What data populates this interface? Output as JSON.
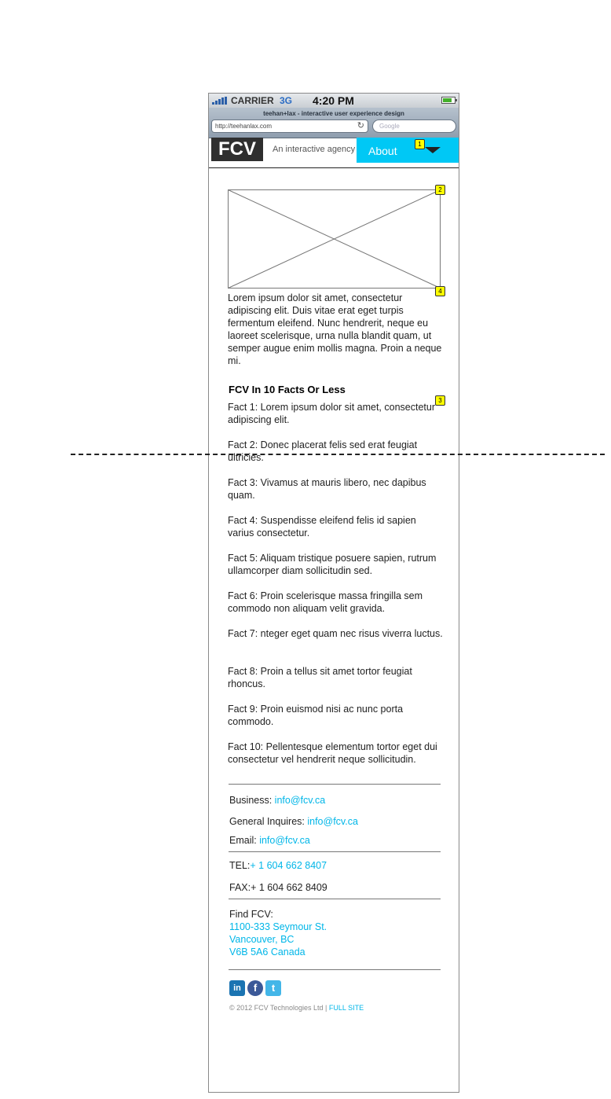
{
  "status_bar": {
    "carrier": "CARRIER",
    "network": "3G",
    "time": "4:20 PM"
  },
  "browser": {
    "title": "teehan+lax - interactive user experience design",
    "url": "http://teehanlax.com",
    "search_placeholder": "Google"
  },
  "header": {
    "logo": "FCV",
    "tagline": "An interactive agency",
    "nav_label": "About"
  },
  "markers": [
    "1",
    "2",
    "3",
    "4"
  ],
  "intro": "Lorem ipsum dolor sit amet, consectetur adipiscing elit. Duis vitae erat eget turpis fermentum eleifend. Nunc hendrerit, neque eu laoreet scelerisque, urna nulla blandit quam, ut semper augue enim mollis magna. Proin a neque mi.",
  "facts_heading": "FCV In 10 Facts Or Less",
  "facts": [
    "Fact 1: Lorem ipsum dolor sit amet, consectetur adipiscing elit.",
    "Fact 2: Donec placerat felis sed erat feugiat ultricies.",
    "Fact 3: Vivamus at mauris libero, nec dapibus quam.",
    "Fact 4: Suspendisse eleifend felis id sapien varius consectetur.",
    "Fact 5: Aliquam tristique posuere sapien, rutrum ullamcorper diam sollicitudin sed.",
    "Fact 6: Proin scelerisque massa fringilla sem commodo non aliquam velit gravida.",
    "Fact 7: nteger eget quam nec risus viverra luctus.",
    "Fact 8: Proin a tellus sit amet tortor feugiat rhoncus.",
    "Fact 9: Proin euismod nisi ac nunc porta commodo.",
    "Fact 10: Pellentesque elementum tortor eget dui consectetur vel hendrerit neque sollicitudin."
  ],
  "contact": {
    "business_label": "Business: ",
    "business_email": "info@fcv.ca",
    "general_label": "General Inquires: ",
    "general_email": "info@fcv.ca",
    "email_label": "Email: ",
    "email": "info@fcv.ca",
    "tel_label": "TEL:",
    "tel": "+ 1 604 662 8407",
    "fax_label": "FAX:",
    "fax": "+ 1 604 662 8409"
  },
  "address": {
    "label": "Find FCV:",
    "line1": "1100-333 Seymour St.",
    "line2": "Vancouver, BC",
    "line3": "V6B 5A6 Canada"
  },
  "social": {
    "linkedin": "in",
    "facebook": "f",
    "twitter": "t"
  },
  "footer": {
    "copyright": "© 2012 FCV Technologies Ltd | ",
    "full_site": "FULL SITE"
  },
  "colors": {
    "accent": "#00c8f5",
    "link": "#00b6e8",
    "logo_bg": "#2f2f2f",
    "marker": "#ffff00"
  }
}
